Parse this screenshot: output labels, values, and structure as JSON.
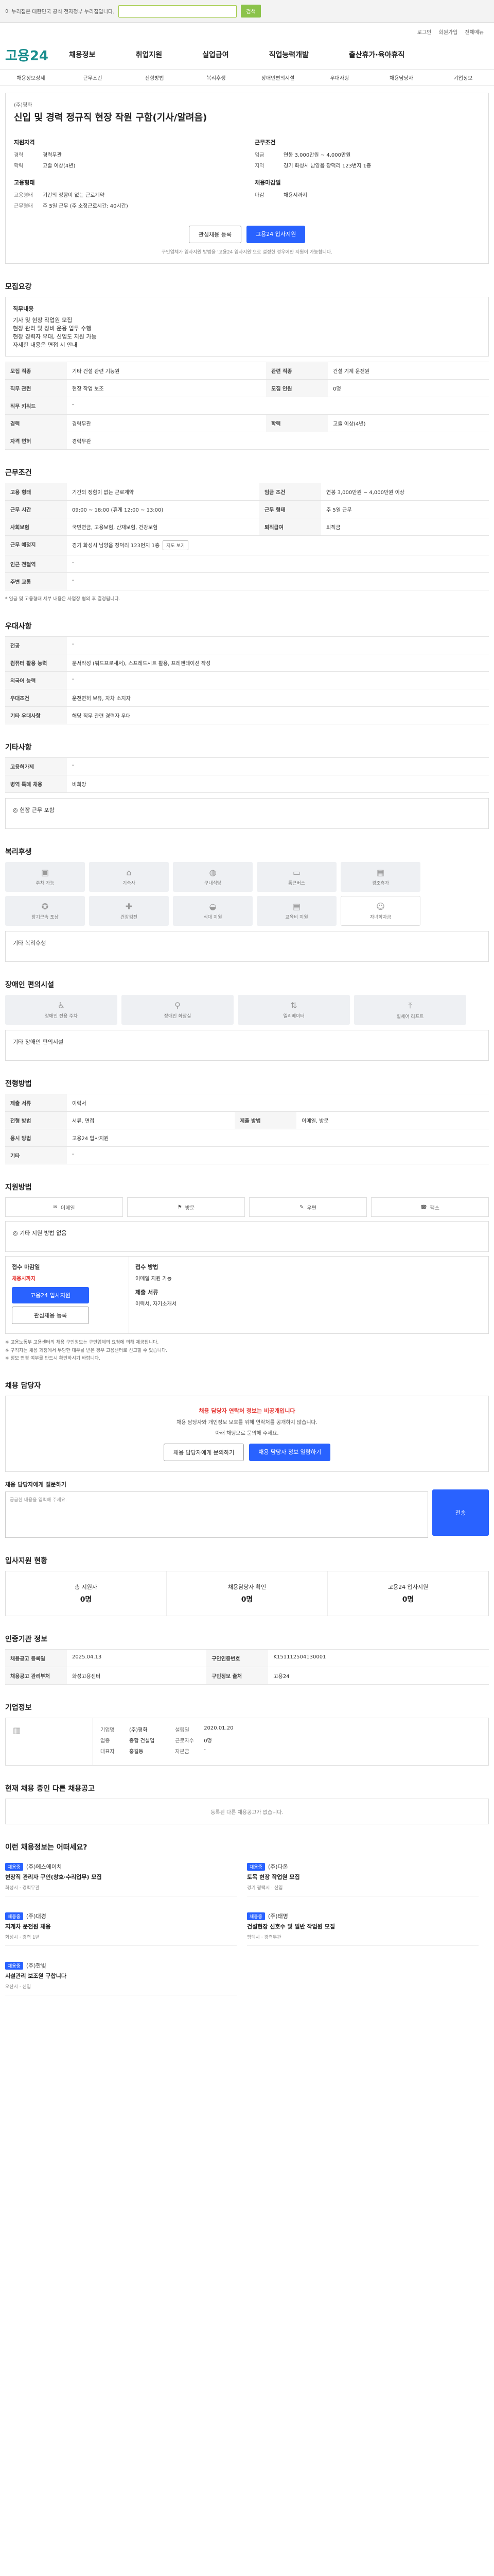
{
  "topbar": {
    "notice": "이 누리집은 대한민국 공식 전자정부 누리집입니다.",
    "button": "검색"
  },
  "util": [
    "로그인",
    "회원가입",
    "전체메뉴"
  ],
  "logo": {
    "main": "고용24",
    "sub": ""
  },
  "gnb": [
    "채용정보",
    "취업지원",
    "실업급여",
    "직업능력개발",
    "출산휴가·육아휴직"
  ],
  "subnav": [
    "채용정보상세",
    "근무조건",
    "전형방법",
    "복리후생",
    "장애인편의시설",
    "우대사항",
    "채용담당자",
    "기업정보"
  ],
  "job": {
    "company": "(주)평화",
    "title": "신입 및 경력 정규직 현장 작원 구함(기사/알려음)",
    "left_title": "지원자격",
    "left": [
      {
        "k": "경력",
        "v": "경력무관"
      },
      {
        "k": "학력",
        "v": "고졸 이상(4년)"
      }
    ],
    "left2_title": "고용형태",
    "left2": [
      {
        "k": "고용형태",
        "v": "기간의 정함이 없는 근로계약"
      },
      {
        "k": "근무형태",
        "v": "주 5일 근무 (주 소정근로시간: 40시간)"
      }
    ],
    "right_title": "근무조건",
    "right": [
      {
        "k": "임금",
        "v": "연봉 3,000만원 ~ 4,000만원"
      },
      {
        "k": "지역",
        "v": "경기 화성시 남양읍 장덕리 123번지 1층"
      }
    ],
    "right2_title": "채용마감일",
    "right2": [
      {
        "k": "마감",
        "v": "채용시까지"
      }
    ],
    "btn_interest": "관심채용 등록",
    "btn_apply": "고용24 입사지원",
    "note": "구인업체가 입사지원 방법을 '고용24 입사지원'으로 설정한 경우에만 지원이 가능합니다."
  },
  "detail": {
    "title": "모집요강",
    "sub": "직무내용",
    "desc": [
      "기사 및 현장 작업원 모집",
      "현장 관리 및 장비 운용 업무 수행",
      "현장 경력자 우대, 신입도 지원 가능",
      "자세한 내용은 면접 시 안내"
    ],
    "rows": [
      {
        "k": "모집 직종",
        "v": "기타 건설 관련 기능원",
        "k2": "관련 직종",
        "v2": "건설 기계 운전원"
      },
      {
        "k": "직무 관련",
        "v": "현장 작업 보조",
        "k2": "모집 인원",
        "v2": "0명"
      },
      {
        "k": "직무 키워드",
        "v": "-",
        "k2": "",
        "v2": ""
      },
      {
        "k": "경력",
        "v": "경력무관",
        "k2": "학력",
        "v2": "고졸 이상(4년)"
      },
      {
        "k": "자격 면허",
        "v": "경력무관",
        "k2": "",
        "v2": ""
      }
    ]
  },
  "conditions": {
    "title": "근무조건",
    "rows": [
      {
        "k": "고용 형태",
        "v": "기간의 정함이 없는 근로계약",
        "k2": "임금 조건",
        "v2": "연봉 3,000만원 ~ 4,000만원 이상"
      },
      {
        "k": "근무 시간",
        "v": "09:00 ~ 18:00 (휴게 12:00 ~ 13:00)",
        "k2": "근무 형태",
        "v2": "주 5일 근무"
      },
      {
        "k": "사회보험",
        "v": "국민연금, 고용보험, 산재보험, 건강보험",
        "k2": "퇴직급여",
        "v2": "퇴직금"
      },
      {
        "k": "근무 예정지",
        "v": "경기 화성시 남양읍 장덕리 123번지 1층",
        "k2": "",
        "v2": ""
      },
      {
        "k": "인근 전철역",
        "v": "-",
        "k2": "",
        "v2": ""
      },
      {
        "k": "주변 교통",
        "v": "-",
        "k2": "",
        "v2": ""
      }
    ],
    "map_badge": "지도 보기",
    "note": "* 임금 및 고용형태 세부 내용은 사업장 협의 후 결정됩니다."
  },
  "prefer": {
    "title": "우대사항",
    "rows": [
      {
        "k": "전공",
        "v": "-"
      },
      {
        "k": "컴퓨터 활용 능력",
        "v": "문서작성 (워드프로세서), 스프레드시트 활용, 프레젠테이션 작성"
      },
      {
        "k": "외국어 능력",
        "v": "-"
      },
      {
        "k": "우대조건",
        "v": "운전면허 보유, 자차 소지자"
      },
      {
        "k": "기타 우대사항",
        "v": "해당 직무 관련 경력자 우대"
      }
    ]
  },
  "extra": {
    "title": "기타사항",
    "rows": [
      {
        "k": "고용허가제",
        "v": "-"
      },
      {
        "k": "병역 특례 채용",
        "v": "비희망"
      }
    ],
    "box": "◎ 현장 근무 포함"
  },
  "welfare": {
    "title": "복리후생",
    "items": [
      "주차 가능",
      "기숙사",
      "구내식당",
      "통근버스",
      "경조휴가",
      "장기근속 포상",
      "건강검진",
      "식대 지원",
      "교육비 지원",
      "자녀학자금"
    ],
    "box": "기타 복리후생"
  },
  "facility": {
    "title": "장애인 편의시설",
    "items": [
      "장애인 전용 주차",
      "장애인 화장실",
      "엘리베이터",
      "휠체어 리프트"
    ],
    "box": "기타 장애인 편의시설"
  },
  "selection": {
    "title": "전형방법",
    "rows": [
      {
        "k": "제출 서류",
        "v": "이력서",
        "k2": "",
        "v2": ""
      },
      {
        "k": "전형 방법",
        "v": "서류, 면접",
        "k2": "제출 방법",
        "v2": "이메일, 방문"
      },
      {
        "k": "응시 방법",
        "v": "고용24 입사지원",
        "k2": "",
        "v2": ""
      },
      {
        "k": "기타",
        "v": "-",
        "k2": "",
        "v2": ""
      }
    ]
  },
  "apply": {
    "title": "지원방법",
    "methods": [
      "이메일",
      "방문",
      "우편",
      "팩스"
    ],
    "box": "◎ 기타 지원 방법 없음",
    "left_label": "접수 마감일",
    "deadline": "채용시까지",
    "btn1": "고용24 입사지원",
    "btn2": "관심채용 등록",
    "right_title": "접수 방법",
    "right1": "이메일 지원 가능",
    "right2_title": "제출 서류",
    "right2": "이력서, 자기소개서",
    "notes": [
      "※ 고용노동부 고용센터의 채용 구인정보는 구인업체의 요청에 의해 제공됩니다.",
      "※ 구직자는 채용 과정에서 부당한 대우를 받은 경우 고용센터로 신고할 수 있습니다.",
      "※ 정보 변경 여부를 반드시 확인하시기 바랍니다."
    ]
  },
  "contact": {
    "title": "채용 담당자",
    "notice": "채용 담당자 연락처 정보는 비공개입니다",
    "desc": "채용 담당자와 개인정보 보호를 위해 연락처를 공개하지 않습니다.",
    "desc2": "아래 채팅으로 문의해 주세요.",
    "btn1": "채용 담당자에게 문의하기",
    "btn2": "채용 담당자 정보 열람하기",
    "chat_label": "채용 담당자에게 질문하기",
    "chat_placeholder": "궁금한 내용을 입력해 주세요.",
    "send": "전송"
  },
  "stats": {
    "title": "입사지원 현황",
    "items": [
      {
        "label": "총 지원자",
        "num": "0명"
      },
      {
        "label": "채용담당자 확인",
        "num": "0명"
      },
      {
        "label": "고용24 입사지원",
        "num": "0명"
      }
    ]
  },
  "info": {
    "title": "인증기관 정보",
    "rows": [
      {
        "k": "채용공고 등록일",
        "v": "2025.04.13",
        "k2": "구인인증번호",
        "v2": "K151112504130001"
      },
      {
        "k": "채용공고 관리부처",
        "v": "화성고용센터",
        "k2": "구인정보 출처",
        "v2": "고용24"
      }
    ]
  },
  "company": {
    "title": "기업정보",
    "rows": [
      {
        "k": "기업명",
        "v": "(주)평화"
      },
      {
        "k": "업종",
        "v": "종합 건설업"
      },
      {
        "k": "대표자",
        "v": "홍길동"
      }
    ],
    "rows2": [
      {
        "k": "설립일",
        "v": "2020.01.20"
      },
      {
        "k": "근로자수",
        "v": "0명"
      },
      {
        "k": "자본금",
        "v": "-"
      }
    ]
  },
  "same": {
    "title": "현재 채용 중인 다른 채용공고",
    "empty": "등록된 다른 채용공고가 없습니다."
  },
  "recommend": {
    "title": "이런 채용정보는 어떠세요?",
    "items": [
      {
        "tag": "채용중",
        "co": "(주)에스에이치",
        "title": "현장직 관리자 구인(창호·수리업무) 모집",
        "meta": "화성시 · 경력무관"
      },
      {
        "tag": "채용중",
        "co": "(주)다온",
        "title": "토목 현장 작업원 모집",
        "meta": "경기 평택시 · 신입"
      },
      {
        "tag": "채용중",
        "co": "(주)대경",
        "title": "지게차 운전원 채용",
        "meta": "화성시 · 경력 1년"
      },
      {
        "tag": "채용중",
        "co": "(주)태명",
        "title": "건설현장 신호수 및 일반 작업원 모집",
        "meta": "평택시 · 경력무관"
      },
      {
        "tag": "채용중",
        "co": "(주)한빛",
        "title": "시설관리 보조원 구합니다",
        "meta": "오산시 · 신입"
      }
    ]
  }
}
